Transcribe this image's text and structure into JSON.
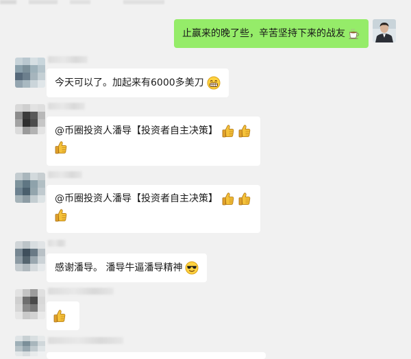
{
  "messages": [
    {
      "side": "right",
      "text": "止赢来的晚了些，辛苦坚持下来的战友",
      "emoji": "tea-icon"
    },
    {
      "side": "left",
      "text": "今天可以了。加起来有6000多美刀",
      "emoji": "grin-icon"
    },
    {
      "side": "left",
      "text": "@币圈投资人潘导【投资者自主决策】",
      "emoji": "thumbs-up-icon",
      "emoji_count": 3
    },
    {
      "side": "left",
      "text": "@币圈投资人潘导【投资者自主决策】",
      "emoji": "thumbs-up-icon",
      "emoji_count": 3
    },
    {
      "side": "left",
      "text": "感谢潘导。 潘导牛逼潘导精神",
      "emoji": "sunglasses-icon"
    },
    {
      "side": "left",
      "text": "",
      "emoji": "thumbs-up-icon",
      "emoji_count": 1
    }
  ],
  "colors": {
    "background": "#f1f1f1",
    "self_bubble": "#95ec69",
    "other_bubble": "#ffffff",
    "text": "#191919"
  }
}
